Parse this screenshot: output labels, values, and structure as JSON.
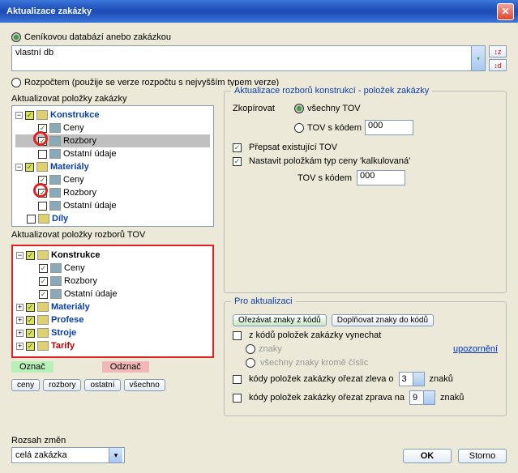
{
  "title": "Aktualizace zakázky",
  "radio1": "Ceníkovou databází anebo zakázkou",
  "dbvalue": "vlastní db",
  "radio2": "Rozpočtem (použije se verze rozpočtu s nejvyšším typem verze)",
  "tree1_label": "Aktualizovat položky zakázky",
  "tree1": {
    "konstrukce": "Konstrukce",
    "ceny": "Ceny",
    "rozbory": "Rozbory",
    "ostatni": "Ostatní údaje",
    "materialy": "Materiály",
    "dily": "Díly"
  },
  "tree2_label": "Aktualizovat položky rozborů TOV",
  "tree2": {
    "konstrukce": "Konstrukce",
    "ceny": "Ceny",
    "rozbory": "Rozbory",
    "ostatni": "Ostatní údaje",
    "materialy": "Materiály",
    "profese": "Profese",
    "stroje": "Stroje",
    "tarify": "Tarify"
  },
  "marks": {
    "oznac": "Označ",
    "odznac": "Odznač"
  },
  "fbtns": {
    "ceny": "ceny",
    "rozbory": "rozbory",
    "ostatni": "ostatní",
    "vsechno": "všechno"
  },
  "panel": {
    "title": "Aktualizace rozborů konstrukcí - položek zakázky",
    "zkopirovat": "Zkopírovat",
    "opt_vsechny": "všechny TOV",
    "opt_skodem": "TOV s kódem",
    "kod1": "000",
    "prepsat": "Přepsat existující TOV",
    "nastavit": "Nastavit položkám typ ceny 'kalkulovaná'",
    "tov_skodem": "TOV s kódem",
    "kod2": "000"
  },
  "proakt": {
    "title": "Pro aktualizaci",
    "orez": "Ořezávat znaky z kódů",
    "dopl": "Doplňovat znaky do kódů",
    "vynechat": "z kódů položek zakázky vynechat",
    "znaky": "znaky",
    "vkrome": "všechny znaky kromě číslic",
    "upoz": "upozornění",
    "zleva": "kódy položek zakázky ořezat zleva o",
    "zprava": "kódy položek zakázky ořezat zprava na",
    "sp1": "3",
    "sp2": "9",
    "znaku": "znaků"
  },
  "rozsah_lbl": "Rozsah změn",
  "rozsah_val": "celá zakázka",
  "ok": "OK",
  "storno": "Storno"
}
